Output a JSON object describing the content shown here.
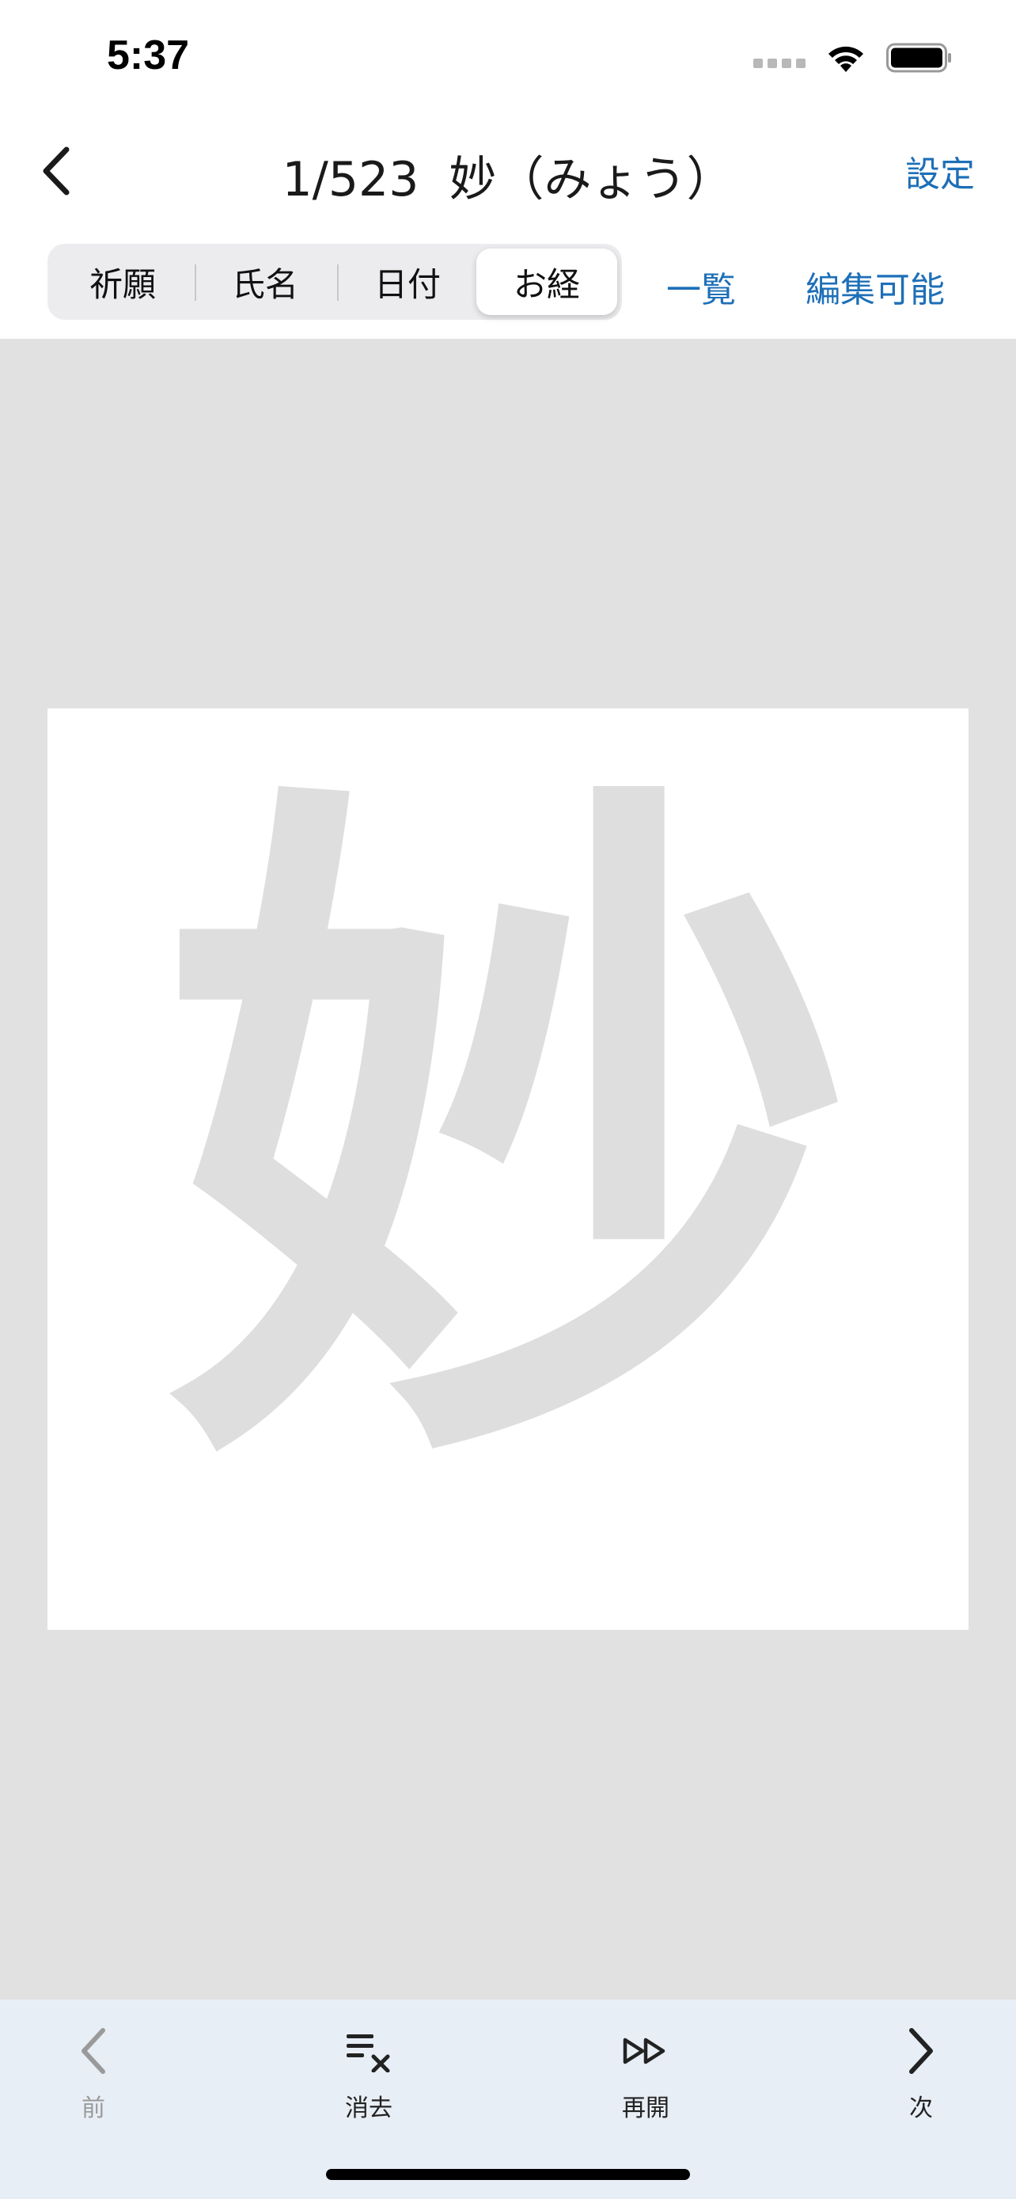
{
  "status_bar": {
    "time": "5:37"
  },
  "nav": {
    "title": "1/523  妙（みょう）",
    "settings_label": "設定"
  },
  "segments": {
    "items": [
      "祈願",
      "氏名",
      "日付",
      "お経"
    ],
    "selected": "お経"
  },
  "toolbar": {
    "list_label": "一覧",
    "editable_label": "編集可能"
  },
  "canvas": {
    "guide_character": "妙"
  },
  "bottom_bar": {
    "prev_label": "前",
    "clear_label": "消去",
    "resume_label": "再開",
    "next_label": "次"
  },
  "colors": {
    "accent": "#1e6fb8",
    "canvas_background": "#e1e1e1",
    "guide_character": "#dedede",
    "bottom_bar": "#e8eef6"
  },
  "icons": {
    "back": "chevron-left-icon",
    "prev": "chevron-left-icon",
    "clear": "clear-list-icon",
    "resume": "fast-forward-icon",
    "next": "chevron-right-icon"
  }
}
